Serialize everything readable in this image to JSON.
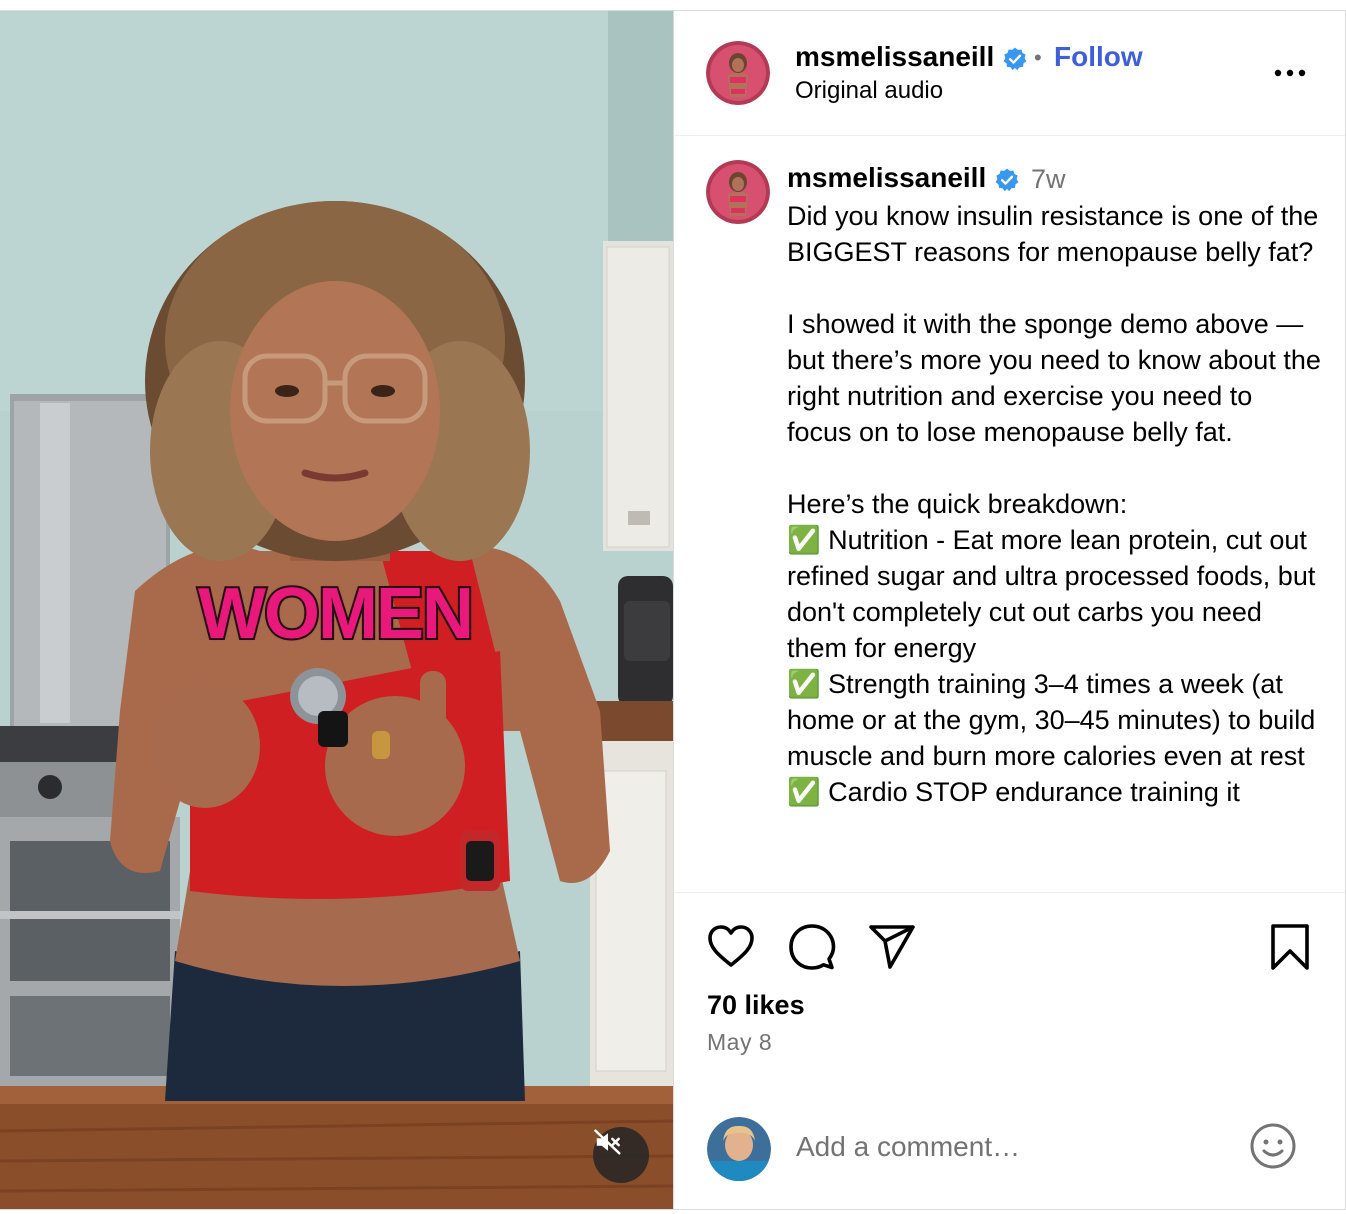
{
  "post": {
    "author": {
      "username": "msmelissaneill",
      "verified": true,
      "follow_label": "Follow",
      "separator": "•",
      "subtitle": "Original audio"
    },
    "video": {
      "overlay_text": "WOMEN",
      "muted": true
    },
    "caption": {
      "username": "msmelissaneill",
      "time_ago": "7w",
      "text": "Did you know insulin resistance is one of the BIGGEST reasons for menopause belly fat?\n\nI showed it with the sponge demo above — but there’s more you need to know about the right nutrition and exercise you need to focus on to lose menopause belly fat.\n\nHere’s the quick breakdown:\n✅ Nutrition - Eat more lean protein, cut out refined sugar and ultra processed foods, but don't completely cut out carbs you need them for energy\n✅ Strength training 3–4 times a week (at home or at the gym, 30–45 minutes) to build muscle and burn more calories even at rest\n✅ Cardio STOP endurance training it"
    },
    "likes": "70 likes",
    "date": "May 8",
    "comment": {
      "placeholder": "Add a comment…"
    }
  },
  "icons": {
    "verified": "verified-badge-icon",
    "more": "more-options-icon",
    "like": "heart-icon",
    "comment": "comment-bubble-icon",
    "share": "paper-plane-icon",
    "save": "bookmark-icon",
    "emoji": "smiley-icon",
    "mute": "speaker-muted-icon"
  },
  "colors": {
    "follow": "#3f5fd9",
    "verified": "#3897f0",
    "overlay_text": "#e8197b",
    "secondary_text": "#737373"
  }
}
